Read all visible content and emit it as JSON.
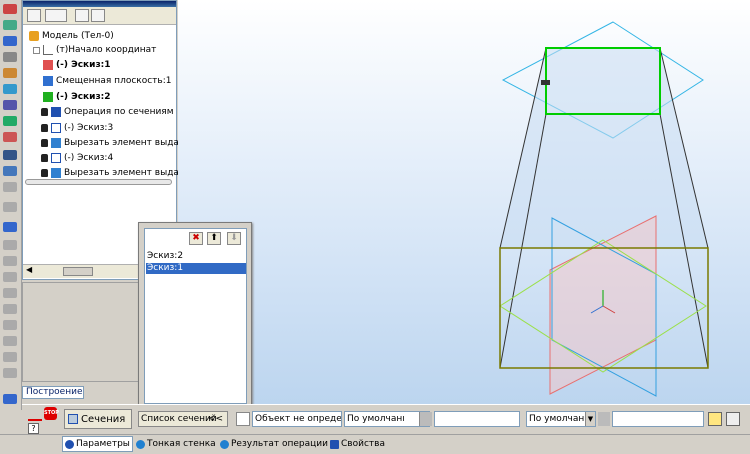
{
  "tree": {
    "items": [
      {
        "label": "Модель (Тел-0)",
        "icon": "model-icon",
        "bold": false,
        "indent": 0,
        "locked": false
      },
      {
        "label": "(т)Начало координат",
        "icon": "origin-icon",
        "bold": false,
        "indent": 1,
        "locked": false
      },
      {
        "label": "(-) Эскиз:1",
        "icon": "sketch-icon",
        "bold": true,
        "indent": 2,
        "locked": false
      },
      {
        "label": "Смещенная плоскость:1",
        "icon": "plane-icon",
        "bold": false,
        "indent": 2,
        "locked": false
      },
      {
        "label": "(-) Эскиз:2",
        "icon": "sketch-icon",
        "bold": true,
        "indent": 2,
        "locked": false
      },
      {
        "label": "Операция по сечениям",
        "icon": "loft-icon",
        "bold": false,
        "indent": 1,
        "locked": true
      },
      {
        "label": "(-) Эскиз:3",
        "icon": "sketch-icon",
        "bold": false,
        "indent": 1,
        "locked": true
      },
      {
        "label": "Вырезать элемент выда",
        "icon": "extrude-cut-icon",
        "bold": false,
        "indent": 1,
        "locked": true
      },
      {
        "label": "(-) Эскиз:4",
        "icon": "sketch-icon",
        "bold": false,
        "indent": 1,
        "locked": true
      },
      {
        "label": "Вырезать элемент выда",
        "icon": "extrude-cut-icon",
        "bold": false,
        "indent": 1,
        "locked": true
      }
    ]
  },
  "section_list": {
    "items": [
      {
        "label": "Эскиз:2",
        "selected": false
      },
      {
        "label": "Эскиз:1",
        "selected": true
      }
    ],
    "buttons": {
      "delete": "✖",
      "up": "⬆",
      "down": "⬇"
    }
  },
  "build_tab": "Построение",
  "property_bar": {
    "section_label": "Сечения",
    "section_list_label": "Список сечений",
    "collapse": "<<",
    "object_field": "Объект не опреде",
    "default_1": "По умолчанı",
    "default_2": "По умолчанı"
  },
  "bottom_tabs": [
    {
      "label": "Параметры",
      "active": true
    },
    {
      "label": "Тонкая стенка",
      "active": false
    },
    {
      "label": "Результат операции",
      "active": false
    },
    {
      "label": "Свойства",
      "active": false
    }
  ],
  "stop_icon_text": "STOP",
  "colors": {
    "accent": "#316ac5",
    "sketch_green": "#00cc00",
    "plane_cyan": "#33b5e5",
    "axis_red": "#e87070",
    "base_olive": "#7a7a00"
  }
}
